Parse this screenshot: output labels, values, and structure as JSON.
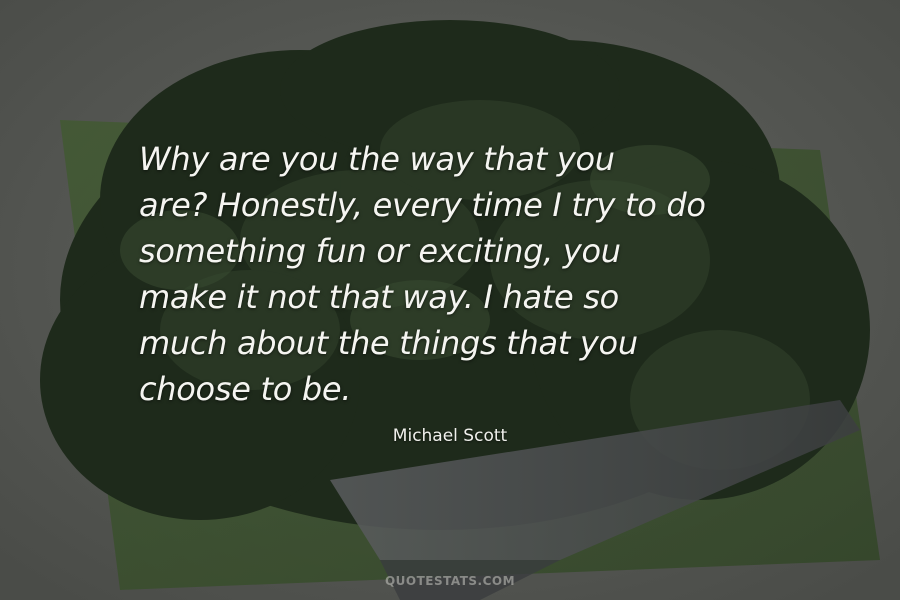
{
  "quote": {
    "lines": [
      "Why are you the way that you",
      "are? Honestly, every time I try to do",
      "something fun or exciting, you",
      "make it not that way. I hate so",
      "much about the things that you",
      "choose to be."
    ],
    "author": "Michael Scott"
  },
  "watermark": "QUOTESTATS.COM",
  "colors": {
    "background": "#545652",
    "text": "#f5f5f1",
    "greens": "#1f2a1c"
  }
}
